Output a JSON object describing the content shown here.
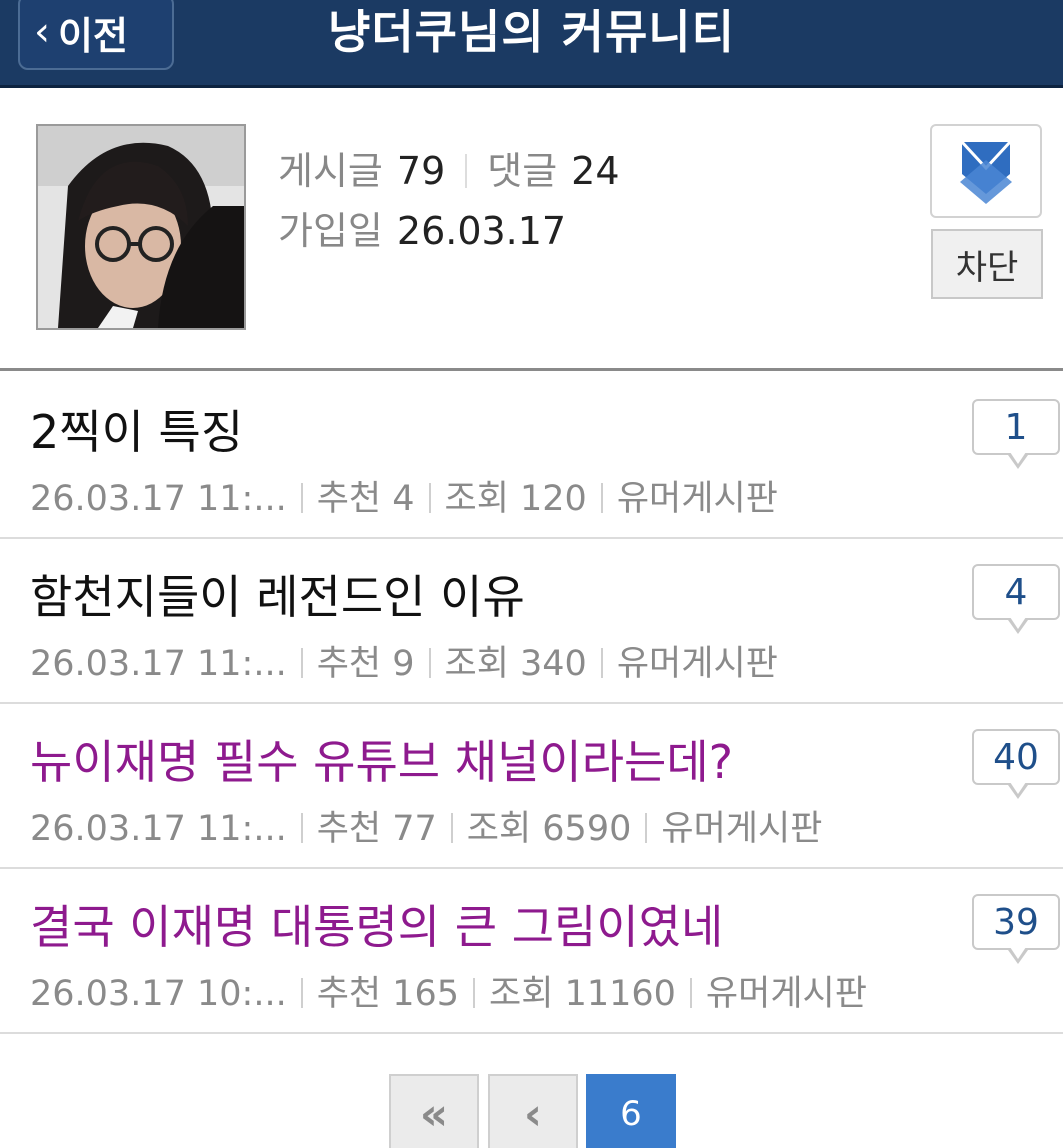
{
  "header": {
    "back_label": "이전",
    "title": "냥더쿠님의 커뮤니티"
  },
  "profile": {
    "posts_label": "게시글",
    "posts_count": "79",
    "comments_label": "댓글",
    "comments_count": "24",
    "joined_label": "가입일",
    "joined_date": "26.03.17",
    "follow_icon": "bookmark-ribbon-icon",
    "block_label": "차단"
  },
  "posts": [
    {
      "title": "2찍이 특징",
      "date": "26.03.17  11:...",
      "recommend": "추천 4",
      "views": "조회 120",
      "board": "유머게시판",
      "replies": "1",
      "hot": false
    },
    {
      "title": "함천지들이 레전드인 이유",
      "date": "26.03.17  11:...",
      "recommend": "추천 9",
      "views": "조회 340",
      "board": "유머게시판",
      "replies": "4",
      "hot": false
    },
    {
      "title": "뉴이재명 필수 유튜브 채널이라는데?",
      "date": "26.03.17  11:...",
      "recommend": "추천 77",
      "views": "조회 6590",
      "board": "유머게시판",
      "replies": "40",
      "hot": true
    },
    {
      "title": "결국 이재명 대통령의 큰 그림이였네",
      "date": "26.03.17  10:...",
      "recommend": "추천 165",
      "views": "조회 11160",
      "board": "유머게시판",
      "replies": "39",
      "hot": true
    }
  ],
  "pagination": {
    "first_label": "«",
    "prev_label": "‹",
    "current_page": "6"
  },
  "colors": {
    "header_bg": "#1b3a63",
    "hot_title": "#8e1a8e",
    "reply_count": "#1f4f8a",
    "current_page": "#3a7ccc"
  }
}
